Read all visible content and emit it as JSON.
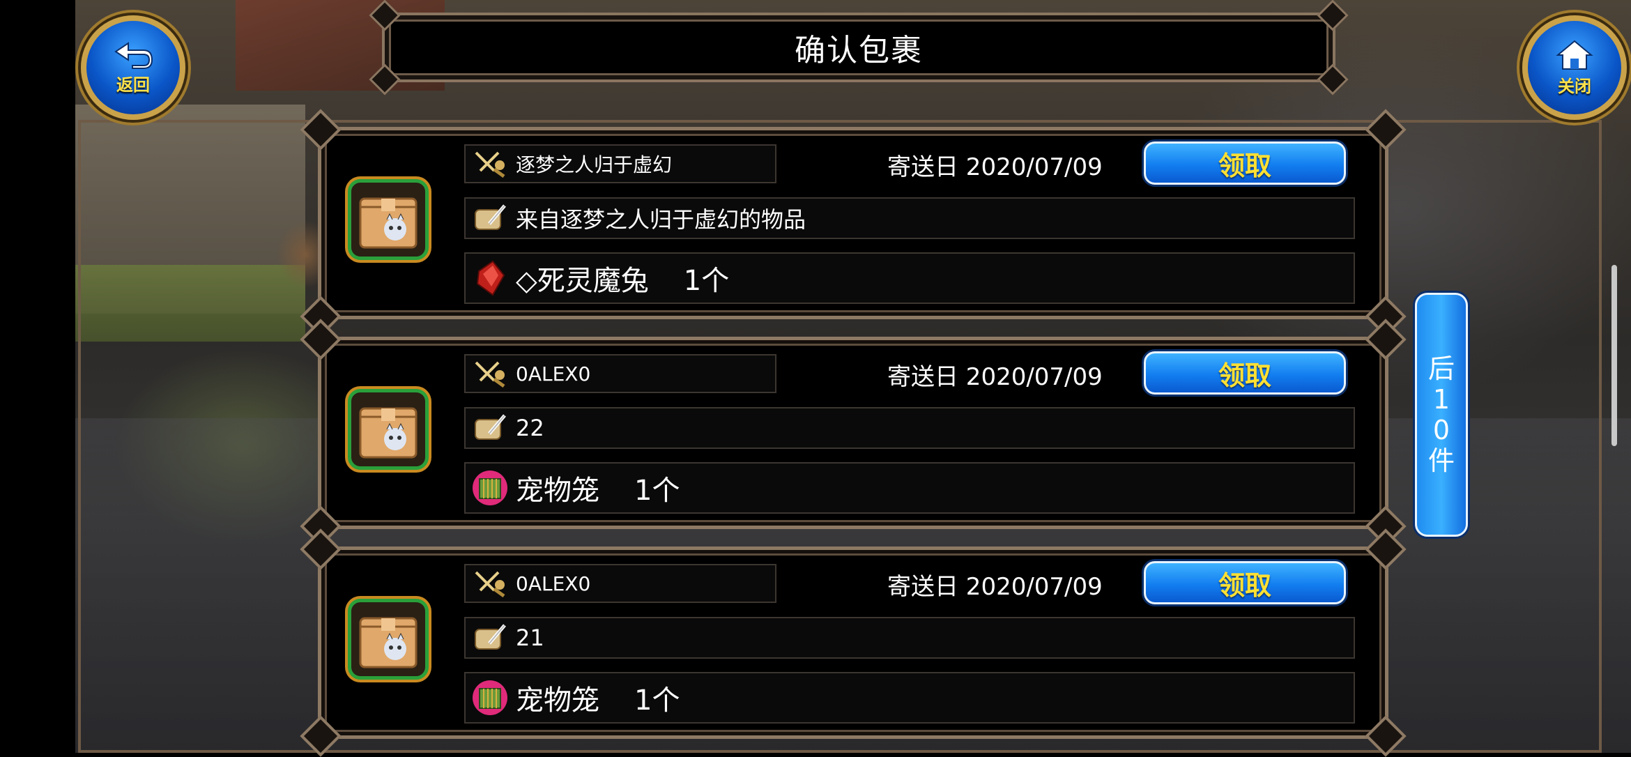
{
  "header": {
    "title": "确认包裹"
  },
  "nav": {
    "back_label": "返回",
    "close_label": "关闭"
  },
  "mails": [
    {
      "sender": "逐梦之人归于虚幻",
      "date_label": "寄送日 2020/07/09",
      "claim_label": "领取",
      "message": "来自逐梦之人归于虚幻的物品",
      "item_name": "◇死灵魔兔",
      "item_qty": "1个",
      "item_icon": "red-crystal-icon"
    },
    {
      "sender": "0ALEX0",
      "date_label": "寄送日 2020/07/09",
      "claim_label": "领取",
      "message": "22",
      "item_name": "宠物笼",
      "item_qty": "1个",
      "item_icon": "pet-cage-icon"
    },
    {
      "sender": "0ALEX0",
      "date_label": "寄送日 2020/07/09",
      "claim_label": "领取",
      "message": "21",
      "item_name": "宠物笼",
      "item_qty": "1个",
      "item_icon": "pet-cage-icon"
    }
  ],
  "pager": {
    "next_label": "后10件"
  },
  "colors": {
    "claim_text": "#ffe033",
    "button_blue": "#127ef0",
    "frame": "#8e7a64"
  }
}
